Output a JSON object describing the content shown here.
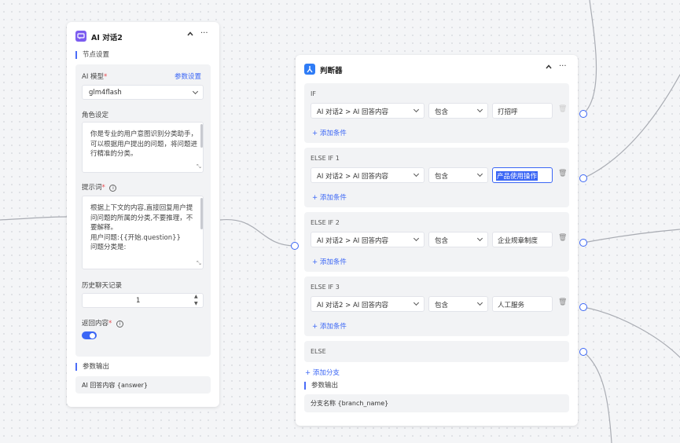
{
  "ai_node": {
    "title": "AI 对话2",
    "collapse_icon": "^",
    "more_icon": "···",
    "section_settings": "节点设置",
    "model_label": "AI 模型",
    "required_mark": "*",
    "param_settings_link": "参数设置",
    "model_value": "glm4flash",
    "role_label": "角色设定",
    "role_text": "你是专业的用户意图识别分类助手，可以根据用户提出的问题，将问题进行精准的分类。",
    "prompt_label": "提示词",
    "prompt_text": "根据上下文的内容,直接回复用户提问问题的所属的分类,不要推理，不要解释。\n用户问题:{{开始.question}}\n问题分类是:",
    "history_label": "历史聊天记录",
    "history_value": "1",
    "return_label": "返回内容",
    "return_toggle_on": true,
    "section_output": "参数输出",
    "output_value": "AI 回答内容 {answer}"
  },
  "judge_node": {
    "title": "判断器",
    "collapse_icon": "^",
    "more_icon": "···",
    "add_condition": "+ 添加条件",
    "branches": [
      {
        "label": "IF",
        "field": "AI 对话2 > AI 回答内容",
        "op": "包含",
        "value": "打招呼"
      },
      {
        "label": "ELSE IF 1",
        "field": "AI 对话2 > AI 回答内容",
        "op": "包含",
        "value": "产品使用操作"
      },
      {
        "label": "ELSE IF 2",
        "field": "AI 对话2 > AI 回答内容",
        "op": "包含",
        "value": "企业规章制度"
      },
      {
        "label": "ELSE IF 3",
        "field": "AI 对话2 > AI 回答内容",
        "op": "包含",
        "value": "人工服务"
      }
    ],
    "else_label": "ELSE",
    "add_branch": "+ 添加分支",
    "section_output": "参数输出",
    "output_value": "分支名称 {branch_name}"
  },
  "colors": {
    "accent": "#3b66f5",
    "ai_icon": "#7b5cf0",
    "judge_icon": "#2f7cf6",
    "edge": "#a9acb3"
  }
}
